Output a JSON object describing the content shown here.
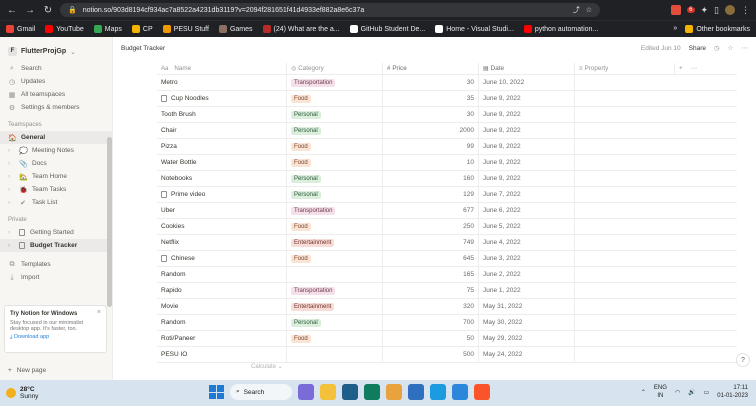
{
  "browser": {
    "url": "notion.so/903d8194cf934ac7a8522a4231db3119?v=2094f281651f41d4933ef882a8e6c37a",
    "notification_count": "6"
  },
  "bookmarks": [
    {
      "label": "Gmail",
      "color": "#ea4335"
    },
    {
      "label": "YouTube",
      "color": "#ff0000"
    },
    {
      "label": "Maps",
      "color": "#34a853"
    },
    {
      "label": "CP",
      "color": "#f4b400"
    },
    {
      "label": "PESU Stuff",
      "color": "#f29900"
    },
    {
      "label": "Games",
      "color": "#8d6e63"
    },
    {
      "label": "(24) What are the a...",
      "color": "#b92b27"
    },
    {
      "label": "GitHub Student De...",
      "color": "#ffffff"
    },
    {
      "label": "Home - Visual Studi...",
      "color": "#ffffff"
    },
    {
      "label": "python automation...",
      "color": "#ff0000"
    }
  ],
  "bookmarks_overflow": "»",
  "other_bookmarks": "Other bookmarks",
  "sidebar": {
    "workspace": "FlutterProjGp",
    "workspace_badge": "F",
    "top_items": [
      {
        "label": "Search",
        "icon": "search-icon",
        "glyph": "⌕"
      },
      {
        "label": "Updates",
        "icon": "clock-icon",
        "glyph": "◷"
      },
      {
        "label": "All teamspaces",
        "icon": "grid-icon",
        "glyph": "▦"
      },
      {
        "label": "Settings & members",
        "icon": "gear-icon",
        "glyph": "⚙"
      }
    ],
    "teamspaces_label": "Teamspaces",
    "teamspace_items": [
      {
        "label": "General",
        "glyph": "🏠",
        "active": true
      },
      {
        "label": "Meeting Notes",
        "glyph": "💭"
      },
      {
        "label": "Docs",
        "glyph": "📎"
      },
      {
        "label": "Team Home",
        "glyph": "🏡"
      },
      {
        "label": "Team Tasks",
        "glyph": "🐞"
      },
      {
        "label": "Task List",
        "glyph": "✔"
      }
    ],
    "private_label": "Private",
    "private_items": [
      {
        "label": "Getting Started",
        "active": false
      },
      {
        "label": "Budget Tracker",
        "active": true
      }
    ],
    "bottom_items": [
      {
        "label": "Templates",
        "glyph": "⧉"
      },
      {
        "label": "Import",
        "glyph": "⤓"
      }
    ],
    "promo": {
      "title": "Try Notion for Windows",
      "text": "Stay focused in our minimalist desktop app. It's faster, too.",
      "link": "Download app"
    },
    "new_page": "New page"
  },
  "topbar": {
    "breadcrumb": "Budget Tracker",
    "edited": "Edited Jun 10",
    "share": "Share"
  },
  "table": {
    "headers": {
      "name": "Name",
      "category": "Category",
      "price": "Price",
      "date": "Date",
      "property": "Property"
    },
    "rows": [
      {
        "name": "Metro",
        "doc": false,
        "category": "Transportation",
        "price": "30",
        "date": "June 10, 2022"
      },
      {
        "name": "Cup Noodles",
        "doc": true,
        "category": "Food",
        "price": "35",
        "date": "June 9, 2022"
      },
      {
        "name": "Tooth Brush",
        "doc": false,
        "category": "Personal",
        "price": "30",
        "date": "June 9, 2022"
      },
      {
        "name": "Chair",
        "doc": false,
        "category": "Personal",
        "price": "2000",
        "date": "June 9, 2022"
      },
      {
        "name": "Pizza",
        "doc": false,
        "category": "Food",
        "price": "99",
        "date": "June 9, 2022"
      },
      {
        "name": "Water Bottle",
        "doc": false,
        "category": "Food",
        "price": "10",
        "date": "June 9, 2022"
      },
      {
        "name": "Notebooks",
        "doc": false,
        "category": "Personal",
        "price": "160",
        "date": "June 9, 2022"
      },
      {
        "name": "Prime video",
        "doc": true,
        "category": "Personal",
        "price": "129",
        "date": "June 7, 2022"
      },
      {
        "name": "Uber",
        "doc": false,
        "category": "Transportation",
        "price": "677",
        "date": "June 6, 2022"
      },
      {
        "name": "Cookies",
        "doc": false,
        "category": "Food",
        "price": "250",
        "date": "June 5, 2022"
      },
      {
        "name": "Netflix",
        "doc": false,
        "category": "Entertainment",
        "price": "749",
        "date": "June 4, 2022"
      },
      {
        "name": "Chinese",
        "doc": true,
        "category": "Food",
        "price": "645",
        "date": "June 3, 2022"
      },
      {
        "name": "Random",
        "doc": false,
        "category": "",
        "price": "165",
        "date": "June 2, 2022"
      },
      {
        "name": "Rapido",
        "doc": false,
        "category": "Transportation",
        "price": "75",
        "date": "June 1, 2022"
      },
      {
        "name": "Movie",
        "doc": false,
        "category": "Entertainment",
        "price": "320",
        "date": "May 31, 2022"
      },
      {
        "name": "Random",
        "doc": false,
        "category": "Personal",
        "price": "700",
        "date": "May 30, 2022"
      },
      {
        "name": "Roti/Paneer",
        "doc": false,
        "category": "Food",
        "price": "50",
        "date": "May 29, 2022"
      },
      {
        "name": "PESU IO",
        "doc": false,
        "category": "",
        "price": "500",
        "date": "May 24, 2022"
      }
    ],
    "calculate": "Calculate ⌄"
  },
  "tag_colors": {
    "Transportation": {
      "bg": "#f5e0e9",
      "fg": "#6c3b51"
    },
    "Food": {
      "bg": "#fbe4d6",
      "fg": "#7a4326"
    },
    "Personal": {
      "bg": "#dbeddb",
      "fg": "#2b593f"
    },
    "Entertainment": {
      "bg": "#fadcd6",
      "fg": "#6e3630"
    }
  },
  "taskbar": {
    "temp": "28°C",
    "weather": "Sunny",
    "search": "Search",
    "lang": "ENG",
    "region": "IN",
    "time": "17:11",
    "date": "01-01-2023"
  }
}
